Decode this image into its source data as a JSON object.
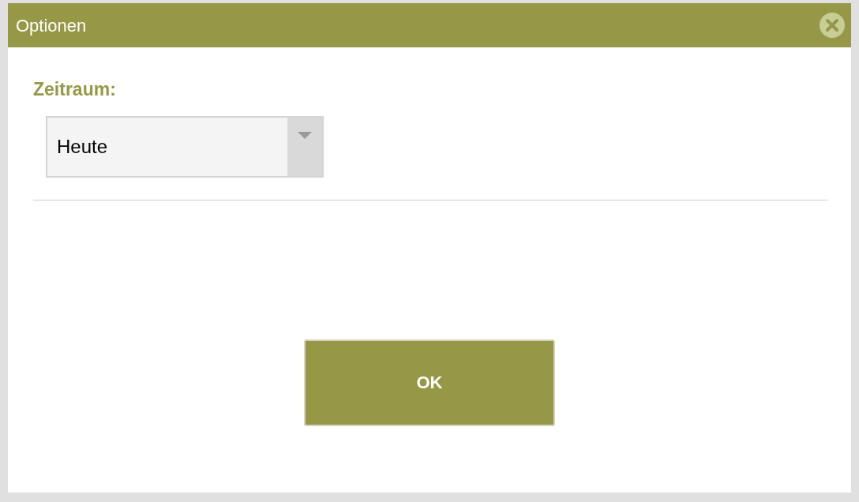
{
  "window": {
    "title": "Optionen"
  },
  "field": {
    "label": "Zeitraum:",
    "value": "Heute"
  },
  "buttons": [
    "OK"
  ]
}
